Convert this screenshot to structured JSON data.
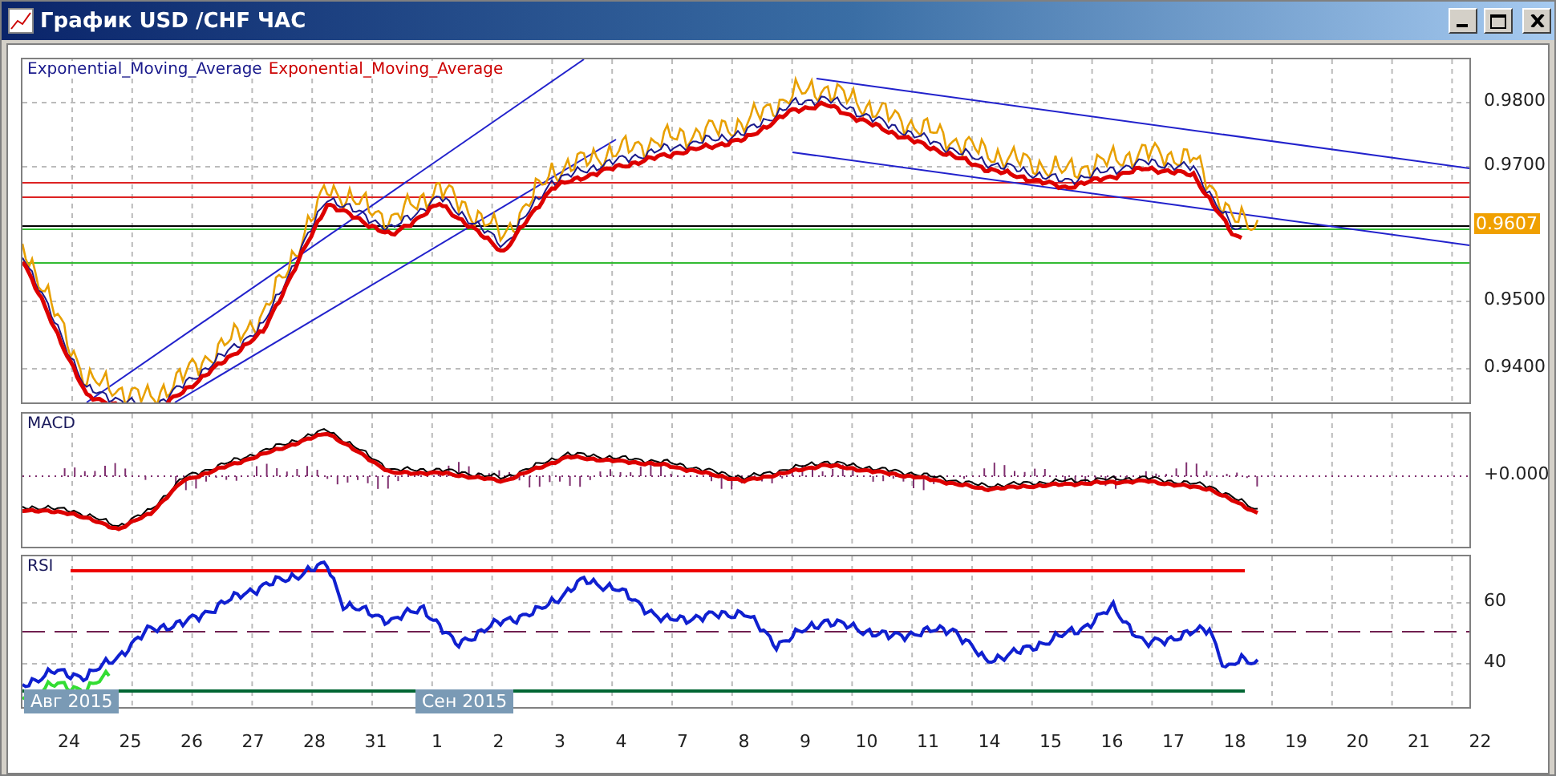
{
  "window": {
    "title": "График USD /CHF ЧАС",
    "buttons": [
      {
        "kind": "minimize"
      },
      {
        "kind": "maximize"
      },
      {
        "kind": "close"
      }
    ]
  },
  "price_pane": {
    "legend": [
      {
        "text": "Exponential_Moving_Average",
        "color": "#1a1a8c"
      },
      {
        "text": "Exponential_Moving_Average",
        "color": "#cc0000"
      }
    ],
    "axis_labels": [
      "0.9800",
      "0.9700",
      "0.9500",
      "0.9400"
    ],
    "current_price": "0.9607"
  },
  "macd_pane": {
    "title": "MACD",
    "axis_labels": [
      "+0.000"
    ]
  },
  "rsi_pane": {
    "title": "RSI",
    "axis_labels": [
      "60",
      "40"
    ]
  },
  "time_axis": {
    "months": [
      "Авг 2015",
      "Сен 2015"
    ],
    "days": [
      "24",
      "25",
      "26",
      "27",
      "28",
      "31",
      "1",
      "2",
      "3",
      "4",
      "7",
      "8",
      "9",
      "10",
      "11",
      "14",
      "15",
      "16",
      "17",
      "18",
      "19",
      "20",
      "21",
      "22"
    ]
  }
}
